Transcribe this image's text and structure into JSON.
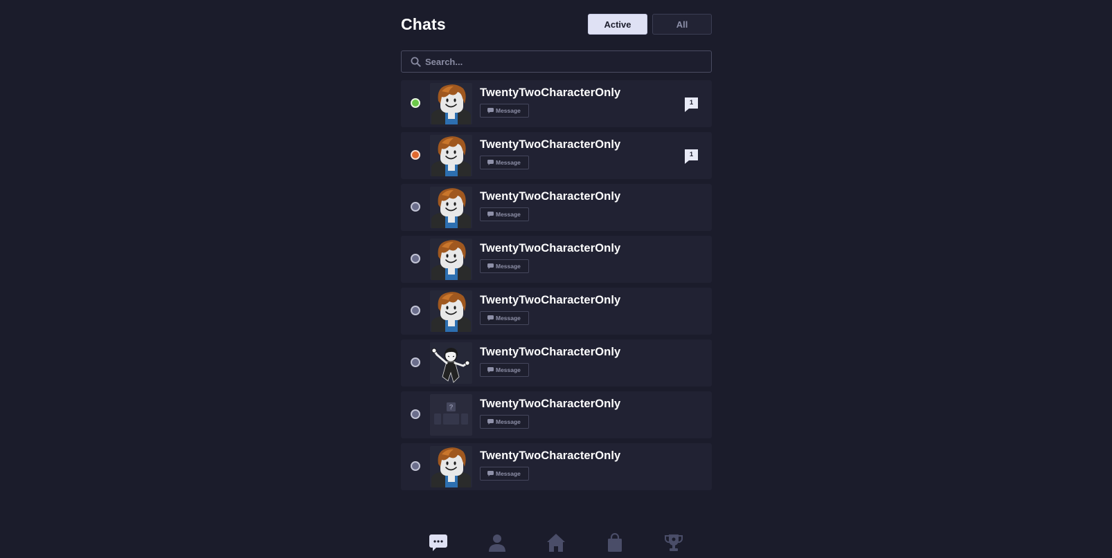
{
  "header": {
    "title": "Chats",
    "tabs": [
      {
        "label": "Active",
        "selected": true
      },
      {
        "label": "All",
        "selected": false
      }
    ]
  },
  "search": {
    "placeholder": "Search...",
    "value": ""
  },
  "chats": [
    {
      "username": "TwentyTwoCharacterOnly",
      "status": "online",
      "avatar": "default-bacon-avatar",
      "message_label": "Message",
      "unread": "1"
    },
    {
      "username": "TwentyTwoCharacterOnly",
      "status": "away",
      "avatar": "default-bacon-avatar",
      "message_label": "Message",
      "unread": "1"
    },
    {
      "username": "TwentyTwoCharacterOnly",
      "status": "offline",
      "avatar": "default-bacon-avatar",
      "message_label": "Message",
      "unread": ""
    },
    {
      "username": "TwentyTwoCharacterOnly",
      "status": "offline",
      "avatar": "default-bacon-avatar",
      "message_label": "Message",
      "unread": ""
    },
    {
      "username": "TwentyTwoCharacterOnly",
      "status": "offline",
      "avatar": "default-bacon-avatar",
      "message_label": "Message",
      "unread": ""
    },
    {
      "username": "TwentyTwoCharacterOnly",
      "status": "offline",
      "avatar": "sketch-character-avatar",
      "message_label": "Message",
      "unread": ""
    },
    {
      "username": "TwentyTwoCharacterOnly",
      "status": "offline",
      "avatar": "placeholder-avatar",
      "message_label": "Message",
      "unread": ""
    },
    {
      "username": "TwentyTwoCharacterOnly",
      "status": "offline",
      "avatar": "default-bacon-avatar",
      "message_label": "Message",
      "unread": ""
    }
  ],
  "bottom_nav": [
    {
      "icon": "chat-bubble-icon",
      "active": true
    },
    {
      "icon": "profile-icon",
      "active": false
    },
    {
      "icon": "home-icon",
      "active": false
    },
    {
      "icon": "shop-bag-icon",
      "active": false
    },
    {
      "icon": "trophy-icon",
      "active": false
    }
  ],
  "colors": {
    "background": "#1b1c2b",
    "row_background": "#212233",
    "status_online": "#6cc949",
    "status_away": "#e0692f",
    "status_offline": "#6b6e8c",
    "accent": "#dfe1f4",
    "nav_inactive": "#4a4d68"
  }
}
